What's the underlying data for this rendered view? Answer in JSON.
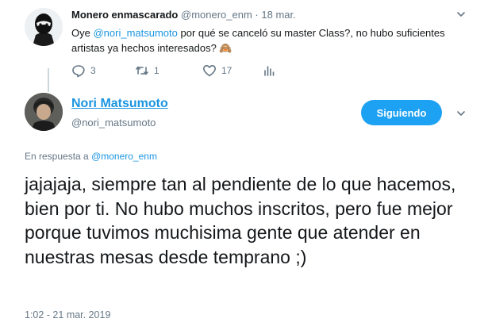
{
  "parent_tweet": {
    "display_name": "Monero enmascarado",
    "handle": "@monero_enm",
    "separator": "·",
    "date": "18 mar.",
    "text_before": "Oye ",
    "mention": "@nori_matsumoto",
    "text_after": " por qué se canceló su master Class?, no hubo suficientes artistas ya hechos interesados? 🙈",
    "reply_count": "3",
    "retweet_count": "1",
    "like_count": "17"
  },
  "main_tweet": {
    "display_name": "Nori Matsumoto",
    "handle": "@nori_matsumoto",
    "follow_label": "Siguiendo",
    "reply_prefix": "En respuesta a ",
    "reply_to": "@monero_enm",
    "text": "jajajaja, siempre tan al pendiente de lo que hacemos, bien por ti. No hubo muchos inscritos, pero fue mejor porque tuvimos muchisima gente que atender en nuestras mesas desde temprano ;)",
    "timestamp": "1:02 - 21 mar. 2019"
  },
  "colors": {
    "accent": "#1b95e0",
    "follow_bg": "#1da1f2",
    "muted": "#657786",
    "text": "#14171a"
  },
  "icons": {
    "reply": "reply-icon",
    "retweet": "retweet-icon",
    "like": "heart-icon",
    "analytics": "analytics-icon",
    "menu": "chevron-down-icon"
  }
}
